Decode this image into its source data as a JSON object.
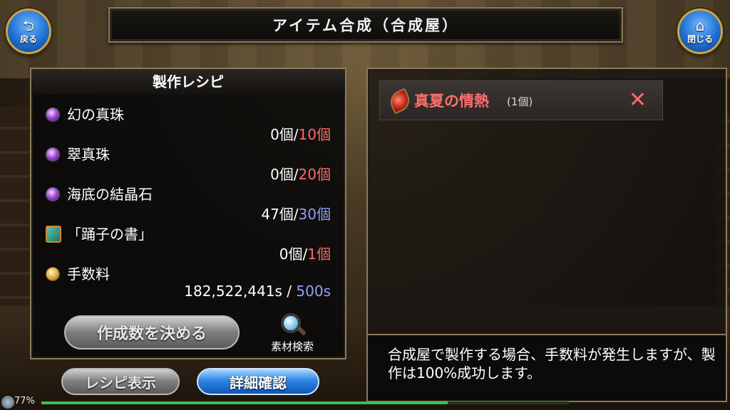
{
  "header": {
    "title": "アイテム合成（合成屋）"
  },
  "nav": {
    "back": {
      "label": "戻る",
      "icon": "back-arrow-icon"
    },
    "close": {
      "label": "閉じる",
      "icon": "home-icon"
    }
  },
  "recipe": {
    "heading": "製作レシピ",
    "materials": [
      {
        "name": "幻の真珠",
        "have": "0個",
        "sep": "/",
        "need": "10個",
        "icon": "pearl-orb-icon",
        "need_color": "red"
      },
      {
        "name": "翠真珠",
        "have": "0個",
        "sep": "/",
        "need": "20個",
        "icon": "pearl-orb-icon",
        "need_color": "red"
      },
      {
        "name": "海底の結晶石",
        "have": "47個",
        "sep": "/",
        "need": "30個",
        "icon": "pearl-orb-icon",
        "need_color": "blue"
      },
      {
        "name": "「踊子の書」",
        "have": "0個",
        "sep": "/",
        "need": "1個",
        "icon": "book-icon",
        "need_color": "red"
      }
    ],
    "fee": {
      "name": "手数料",
      "have": "182,522,441s",
      "sep": " / ",
      "need": "500s",
      "icon": "coins-icon"
    },
    "quantity_button": "作成数を決める",
    "search_label": "素材検索"
  },
  "buttons": {
    "recipe_display": "レシピ表示",
    "detail_confirm": "詳細確認"
  },
  "result": {
    "item_name": "真夏の情熱",
    "item_qty": "(1個)",
    "remove_symbol": "✕"
  },
  "message": "合成屋で製作する場合、手数料が発生しますが、製作は100%成功します。",
  "status": {
    "battery_text": "77%",
    "battery_level": 0.77
  },
  "colors": {
    "need_red": "#ff6a6a",
    "need_blue": "#8fa0ff",
    "accent_blue": "#2f87e6"
  }
}
